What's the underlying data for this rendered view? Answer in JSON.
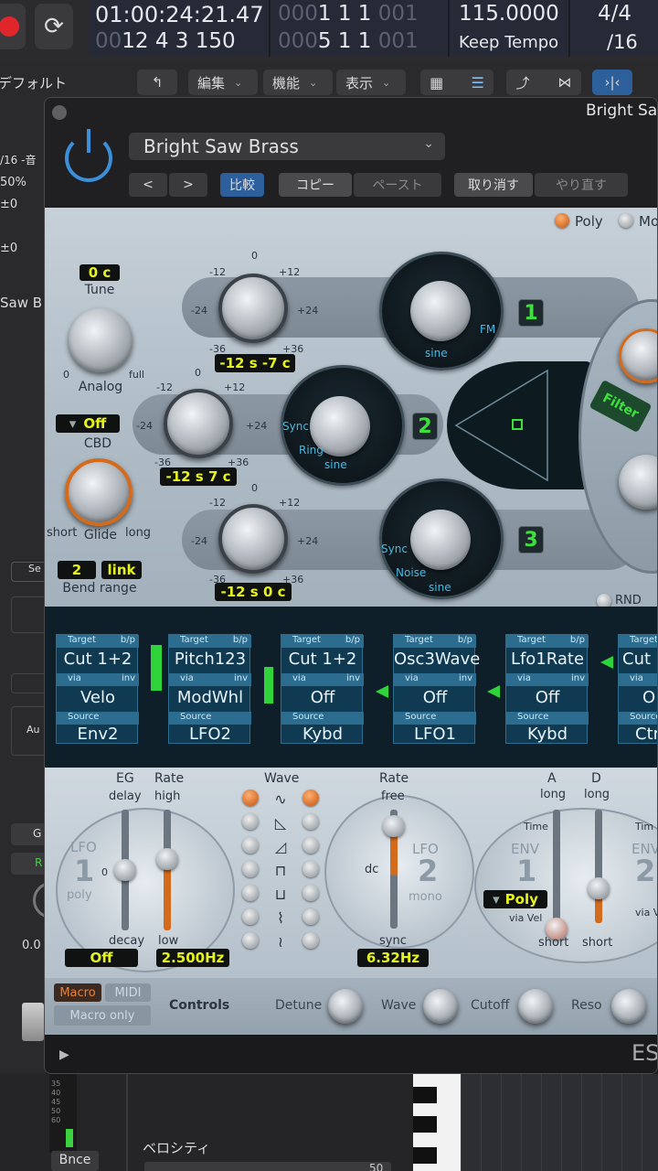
{
  "transport": {
    "time": "01:00:24:21.47",
    "time_position": "12 4 3 150",
    "bar_top_pre": "000",
    "bar_top": "1 1 1",
    "bar_top_post": "001",
    "bar_bottom_pre": "000",
    "bar_bottom": "5 1 1",
    "bar_bottom_post": "001",
    "bar_bottom_lead": "00",
    "tempo": "115.0000",
    "tempo_mode": "Keep Tempo",
    "signature": "4/4",
    "division": "/16"
  },
  "toolbar": {
    "edit": "編集",
    "functions": "機能",
    "view": "表示"
  },
  "inspector": {
    "default_label": "デフォルト",
    "quantize": "/16 -音",
    "percent": "50%",
    "v1": "±0",
    "v2": "±0",
    "track_name": "Saw B",
    "s_label": "Se",
    "au_label": "Au",
    "g_label": "G",
    "r_label": "R",
    "value": "0.0",
    "bounce": "Bnce",
    "meter_scale": [
      "35",
      "40",
      "45",
      "50",
      "60"
    ]
  },
  "plugin": {
    "window_title": "Bright Saw",
    "preset_name": "Bright Saw Brass",
    "prev": "<",
    "next": ">",
    "compare": "比較",
    "copy": "コピー",
    "paste": "ペースト",
    "undo": "取り消す",
    "redo": "やり直す",
    "footer_text": "ES"
  },
  "synth": {
    "poly": "Poly",
    "mono": "Mo",
    "tune_value": "0 c",
    "tune_label": "Tune",
    "analog_label": "Analog",
    "analog_min": "0",
    "analog_max": "full",
    "cbd_value": "Off",
    "cbd_label": "CBD",
    "glide_label": "Glide",
    "glide_min": "short",
    "glide_max": "long",
    "bend_value": "2",
    "bend_link": "link",
    "bend_label": "Bend range",
    "filter_label": "Filter",
    "rnd_label": "RND",
    "osc_scale": [
      "0",
      "-12",
      "+12",
      "-24",
      "+24",
      "-36",
      "+36"
    ],
    "osc1_tune": "-12 s -7 c",
    "osc2_tune": "-12 s 7 c",
    "osc3_tune": "-12 s 0 c",
    "osc1_num": "1",
    "osc2_num": "2",
    "osc3_num": "3",
    "osc1_wave": "sine",
    "osc1_fm": "FM",
    "osc2_wave": "sine",
    "osc2_sync": "Sync",
    "osc2_ring": "Ring",
    "osc3_wave": "sine",
    "osc3_sync": "Sync",
    "osc3_noise": "Noise"
  },
  "router": {
    "target_label": "Target",
    "bp_label": "b/p",
    "via_label": "via",
    "inv_label": "inv",
    "source_label": "Source",
    "slots": [
      {
        "target": "Cut 1+2",
        "via": "Velo",
        "source": "Env2"
      },
      {
        "target": "Pitch123",
        "via": "ModWhl",
        "source": "LFO2"
      },
      {
        "target": "Cut 1+2",
        "via": "Off",
        "source": "Kybd"
      },
      {
        "target": "Osc3Wave",
        "via": "Off",
        "source": "LFO1"
      },
      {
        "target": "Lfo1Rate",
        "via": "Off",
        "source": "Kybd"
      },
      {
        "target": "Cut",
        "via": "O",
        "source": "Ctr"
      }
    ]
  },
  "lfo": {
    "eg_label": "EG",
    "delay_label": "delay",
    "decay_label": "decay",
    "rate_label": "Rate",
    "high_label": "high",
    "low_label": "low",
    "lfo1_label": "LFO",
    "lfo1_num": "1",
    "lfo1_mode": "poly",
    "lfo1_zero": "0",
    "eg_value": "Off",
    "rate_value": "2.500Hz",
    "wave_label": "Wave",
    "lfo2_rate_label": "Rate",
    "lfo2_free": "free",
    "lfo2_dc": "dc",
    "lfo2_label": "LFO",
    "lfo2_num": "2",
    "lfo2_mode": "mono",
    "lfo2_sync": "sync",
    "lfo2_value": "6.32Hz",
    "env_a": "A",
    "env_d": "D",
    "env_long": "long",
    "env_short": "short",
    "env_time": "Time",
    "env1_label": "ENV",
    "env1_num": "1",
    "env1_mode": "Poly",
    "env1_via": "via Vel",
    "env2_label": "ENV",
    "env2_num": "2",
    "env2_time": "Tim",
    "env2_via": "via V"
  },
  "controls": {
    "macro": "Macro",
    "midi": "MIDI",
    "macro_only": "Macro only",
    "title": "Controls",
    "detune": "Detune",
    "wave": "Wave",
    "cutoff": "Cutoff",
    "reso": "Reso"
  },
  "bottom": {
    "velocity_label": "ベロシティ",
    "velocity_value": "50"
  },
  "colors": {
    "accent_orange": "#d46a1c",
    "lcd_green": "#e7f31c",
    "osc_green": "#3ee03e",
    "router_blue": "#103a52",
    "link_blue": "#2c6fd8"
  }
}
